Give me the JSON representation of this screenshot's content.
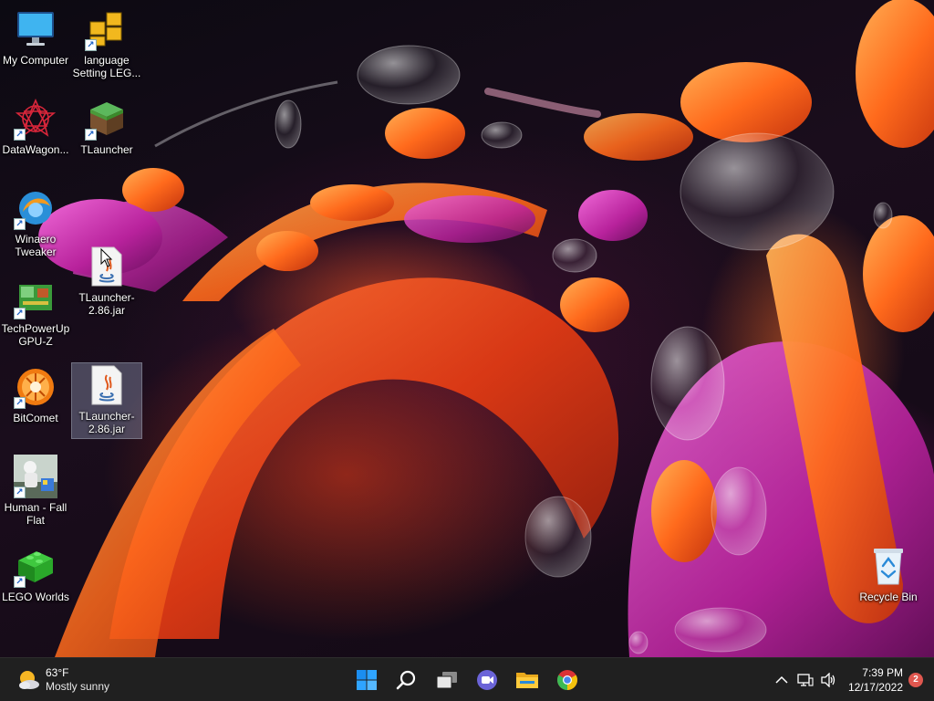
{
  "desktop": {
    "icons": [
      {
        "label": "My Computer",
        "icon": "monitor-icon",
        "shortcut": false
      },
      {
        "label": "language Setting LEG...",
        "icon": "grid-folder-icon",
        "shortcut": true
      },
      {
        "label": "DataWagon...",
        "icon": "star-pattern-icon",
        "shortcut": true
      },
      {
        "label": "TLauncher",
        "icon": "grass-block-icon",
        "shortcut": true
      },
      {
        "label": "Winaero Tweaker",
        "icon": "winaero-icon",
        "shortcut": true
      },
      {
        "label": "TLauncher-2.86.jar",
        "icon": "java-file-icon",
        "shortcut": false
      },
      {
        "label": "TechPowerUp GPU-Z",
        "icon": "gpu-card-icon",
        "shortcut": true
      },
      {
        "label": "BitComet",
        "icon": "bitcomet-icon",
        "shortcut": true
      },
      {
        "label": "TLauncher-2.86.jar",
        "icon": "java-file-icon",
        "shortcut": false
      },
      {
        "label": "Human - Fall Flat",
        "icon": "human-game-icon",
        "shortcut": true
      },
      {
        "label": "LEGO Worlds",
        "icon": "lego-brick-icon",
        "shortcut": true
      },
      {
        "label": "Recycle Bin",
        "icon": "recycle-bin-icon",
        "shortcut": false
      }
    ]
  },
  "taskbar": {
    "weather": {
      "temp": "63°F",
      "condition": "Mostly sunny"
    },
    "pinned": [
      "start-icon",
      "search-icon",
      "task-view-icon",
      "teams-chat-icon",
      "file-explorer-icon",
      "chrome-icon"
    ],
    "clock": {
      "time": "7:39 PM",
      "date": "12/17/2022"
    },
    "notifications": "2"
  },
  "colors": {
    "taskbar_bg": "#202020",
    "notification_badge": "#e0574f",
    "windows_blue": "#1b8ef0"
  }
}
